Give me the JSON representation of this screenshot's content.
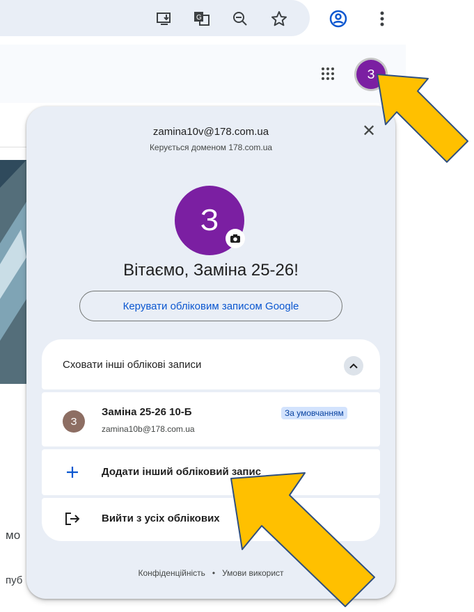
{
  "browser": {
    "toolbar_icons": [
      "install-app-icon",
      "translate-icon",
      "zoom-out-icon",
      "bookmark-star-icon",
      "profile-icon",
      "more-menu-icon"
    ]
  },
  "header": {
    "apps_icon": "apps-grid-icon",
    "avatar_letter": "З"
  },
  "background": {
    "text_1": "мо",
    "text_2": "пуб"
  },
  "popup": {
    "email": "zamina10v@178.com.ua",
    "managed_by": "Керується доменом 178.com.ua",
    "avatar_letter": "З",
    "greeting": "Вітаємо, Заміна 25-26!",
    "manage_button": "Керувати обліковим записом Google",
    "hide_accounts": "Сховати інші облікові записи",
    "other_account": {
      "avatar_letter": "З",
      "name": "Заміна 25-26 10-Б",
      "email": "zamina10b@178.com.ua",
      "badge": "За умовчанням"
    },
    "add_account": "Додати інший обліковий запис",
    "sign_out": "Вийти з усіх облікових",
    "footer": {
      "privacy": "Конфіденційність",
      "separator": "•",
      "terms": "Умови використ"
    }
  },
  "colors": {
    "accent_blue": "#0b57d0",
    "avatar_purple": "#7b1fa2",
    "avatar_brown": "#8d6e63",
    "arrow_yellow": "#ffc000",
    "popup_bg": "#e9eef6"
  }
}
